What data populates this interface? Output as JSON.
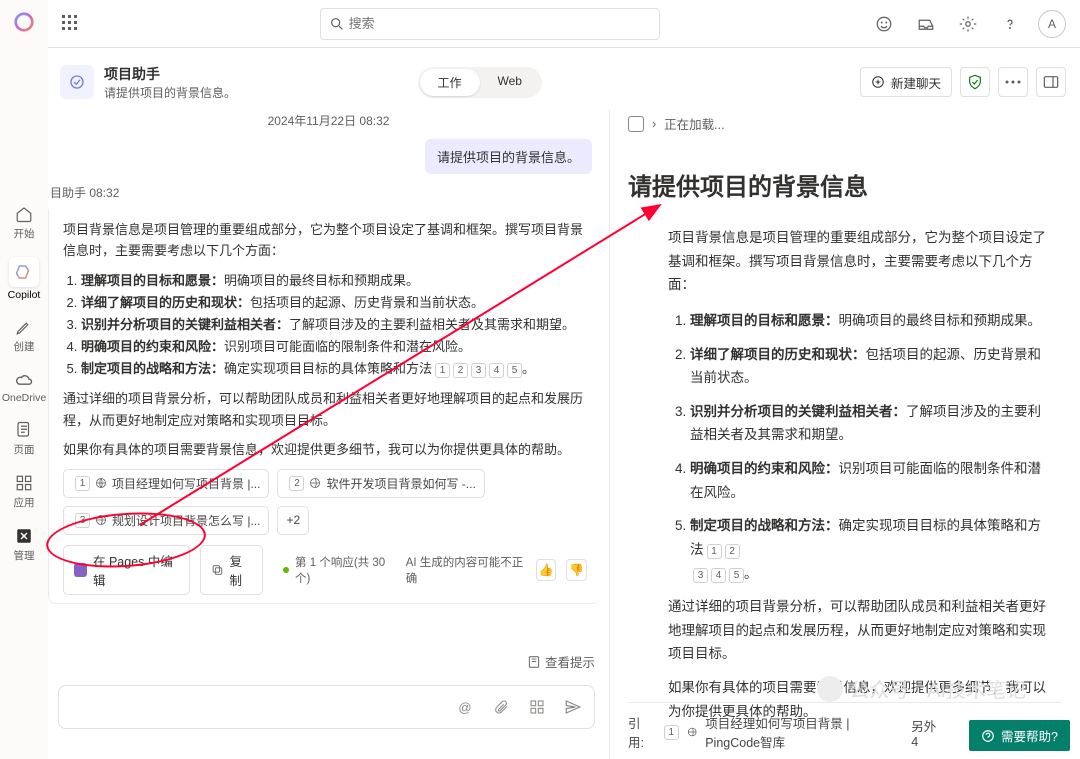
{
  "search": {
    "placeholder": "搜索"
  },
  "rail": {
    "items": [
      "开始",
      "Copilot",
      "创建",
      "OneDrive",
      "页面",
      "应用",
      "管理"
    ]
  },
  "avatar": "A",
  "assistant": {
    "title": "项目助手",
    "subtitle": "请提供项目的背景信息。"
  },
  "tabs": {
    "work": "工作",
    "web": "Web"
  },
  "controls": {
    "newchat": "新建聊天"
  },
  "date": "2024年11月22日 08:32",
  "user_msg": "请提供项目的背景信息。",
  "bot_meta": "目助手 08:32",
  "bot": {
    "p1": "项目背景信息是项目管理的重要组成部分，它为整个项目设定了基调和框架。撰写项目背景信息时，主要需要考虑以下几个方面：",
    "li1b": "理解项目的目标和愿景：",
    "li1": "明确项目的最终目标和预期成果。",
    "li2b": "详细了解项目的历史和现状：",
    "li2": "包括项目的起源、历史背景和当前状态。",
    "li3b": "识别并分析项目的关键利益相关者：",
    "li3": "了解项目涉及的主要利益相关者及其需求和期望。",
    "li4b": "明确项目的约束和风险：",
    "li4": "识别项目可能面临的限制条件和潜在风险。",
    "li5b": "制定项目的战略和方法：",
    "li5": "确定实现项目目标的具体策略和方法",
    "p2": "通过详细的项目背景分析，可以帮助团队成员和利益相关者更好地理解项目的起点和发展历程，从而更好地制定应对策略和实现项目目标。",
    "p3": "如果你有具体的项目需要背景信息，欢迎提供更多细节，我可以为你提供更具体的帮助。"
  },
  "suggestions": {
    "s1": "项目经理如何写项目背景 |...",
    "s2": "软件开发项目背景如何写 -...",
    "s3": "规划设计项目背景怎么写 |...",
    "more": "+2"
  },
  "actions": {
    "pages": "在 Pages 中编辑",
    "copy": "复制",
    "count": "第 1 个响应(共 30 个)",
    "ai": "AI 生成的内容可能不正确"
  },
  "viewhint": "查看提示",
  "doc": {
    "loading": "正在加载...",
    "h1": "请提供项目的背景信息",
    "p1": "项目背景信息是项目管理的重要组成部分，它为整个项目设定了基调和框架。撰写项目背景信息时，主要需要考虑以下几个方面：",
    "li1b": "理解项目的目标和愿景：",
    "li1": "明确项目的最终目标和预期成果。",
    "li2b": "详细了解项目的历史和现状：",
    "li2": "包括项目的起源、历史背景和当前状态。",
    "li3b": "识别并分析项目的关键利益相关者：",
    "li3": "了解项目涉及的主要利益相关者及其需求和期望。",
    "li4b": "明确项目的约束和风险：",
    "li4": "识别项目可能面临的限制条件和潜在风险。",
    "li5b": "制定项目的战略和方法：",
    "li5": "确定实现项目目标的具体策略和方法",
    "p2": "通过详细的项目背景分析，可以帮助团队成员和利益相关者更好地理解项目的起点和发展历程，从而更好地制定应对策略和实现项目目标。",
    "p3": "如果你有具体的项目需要背景信息，欢迎提供更多细节，我可以为你提供更具体的帮助。"
  },
  "footer": {
    "label": "引用:",
    "cite": "项目经理如何写项目背景 | PingCode智库",
    "extra": "另外 4"
  },
  "help": "需要帮助?",
  "watermark": "公众号 · AI技术笔记"
}
